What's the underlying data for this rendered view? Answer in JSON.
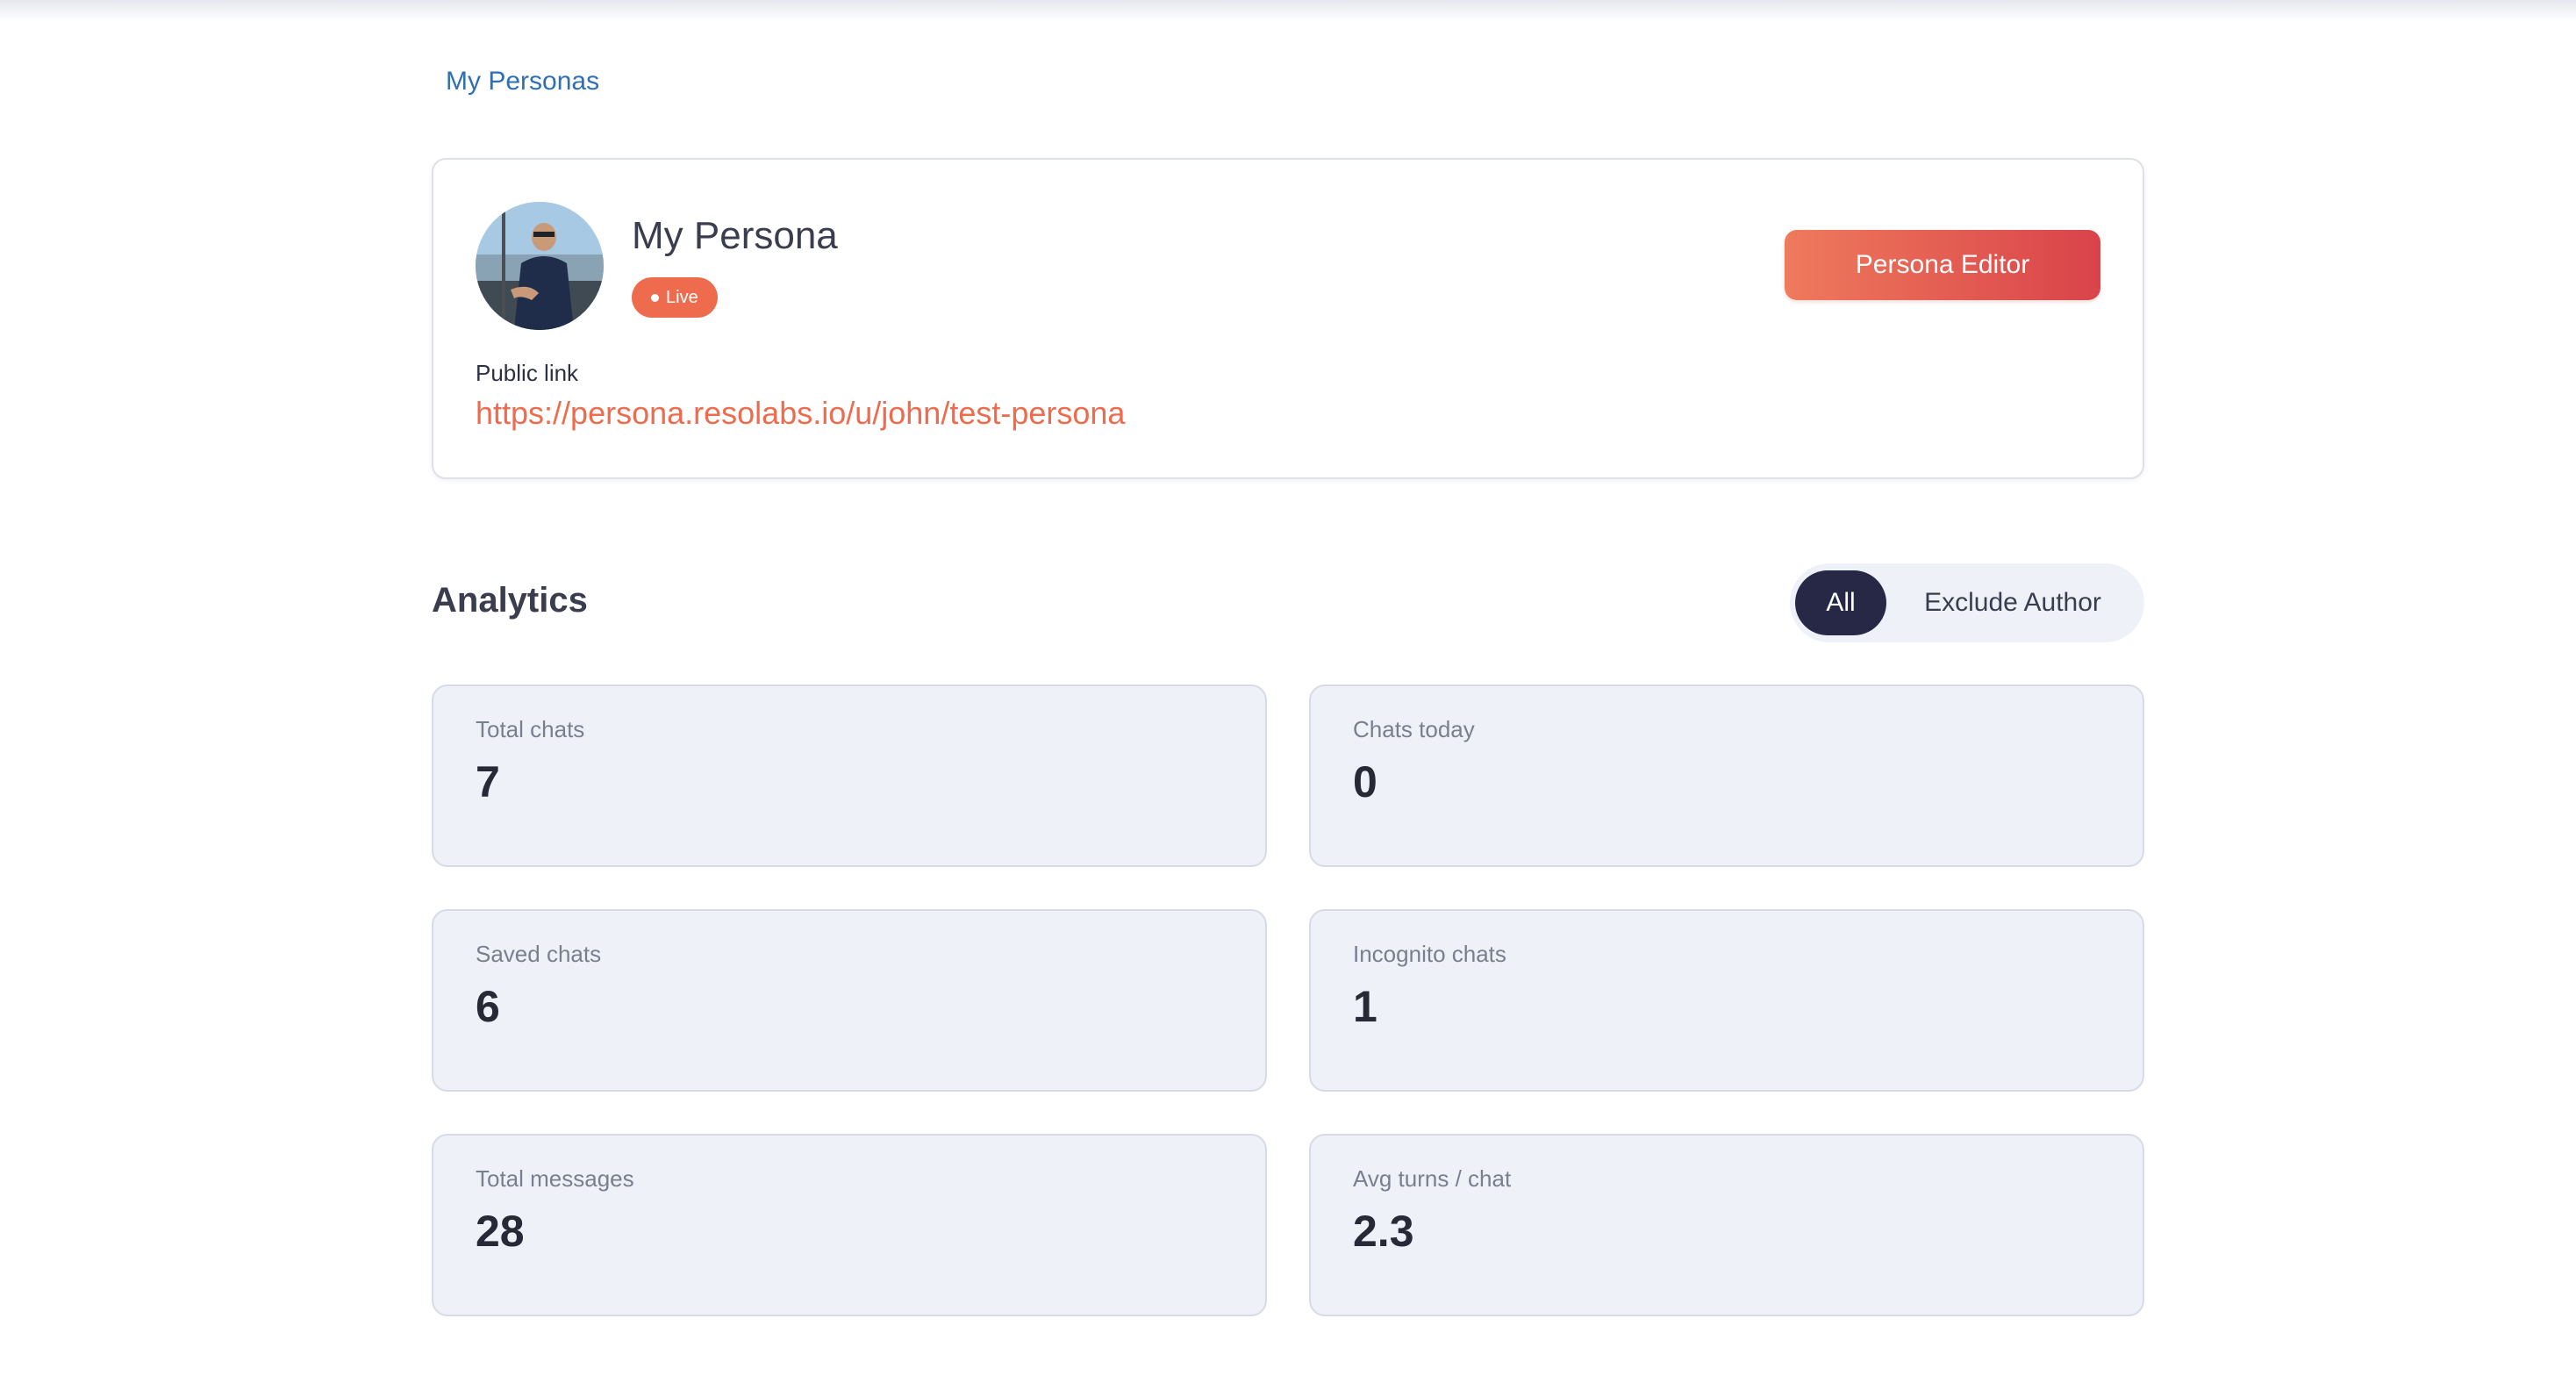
{
  "breadcrumb": {
    "label": "My Personas"
  },
  "persona": {
    "name": "My Persona",
    "status": "Live",
    "editor_button": "Persona Editor",
    "public_link_label": "Public link",
    "public_link_url": "https://persona.resolabs.io/u/john/test-persona"
  },
  "analytics": {
    "title": "Analytics",
    "filter": {
      "options": [
        "All",
        "Exclude Author"
      ],
      "selected": "All"
    },
    "stats": [
      {
        "label": "Total chats",
        "value": "7"
      },
      {
        "label": "Chats today",
        "value": "0"
      },
      {
        "label": "Saved chats",
        "value": "6"
      },
      {
        "label": "Incognito chats",
        "value": "1"
      },
      {
        "label": "Total messages",
        "value": "28"
      },
      {
        "label": "Avg turns / chat",
        "value": "2.3"
      }
    ]
  },
  "colors": {
    "accent": "#ee6c4d",
    "link": "#2f6fb3",
    "toggle_active": "#272846",
    "card_bg": "#eef1f8"
  }
}
